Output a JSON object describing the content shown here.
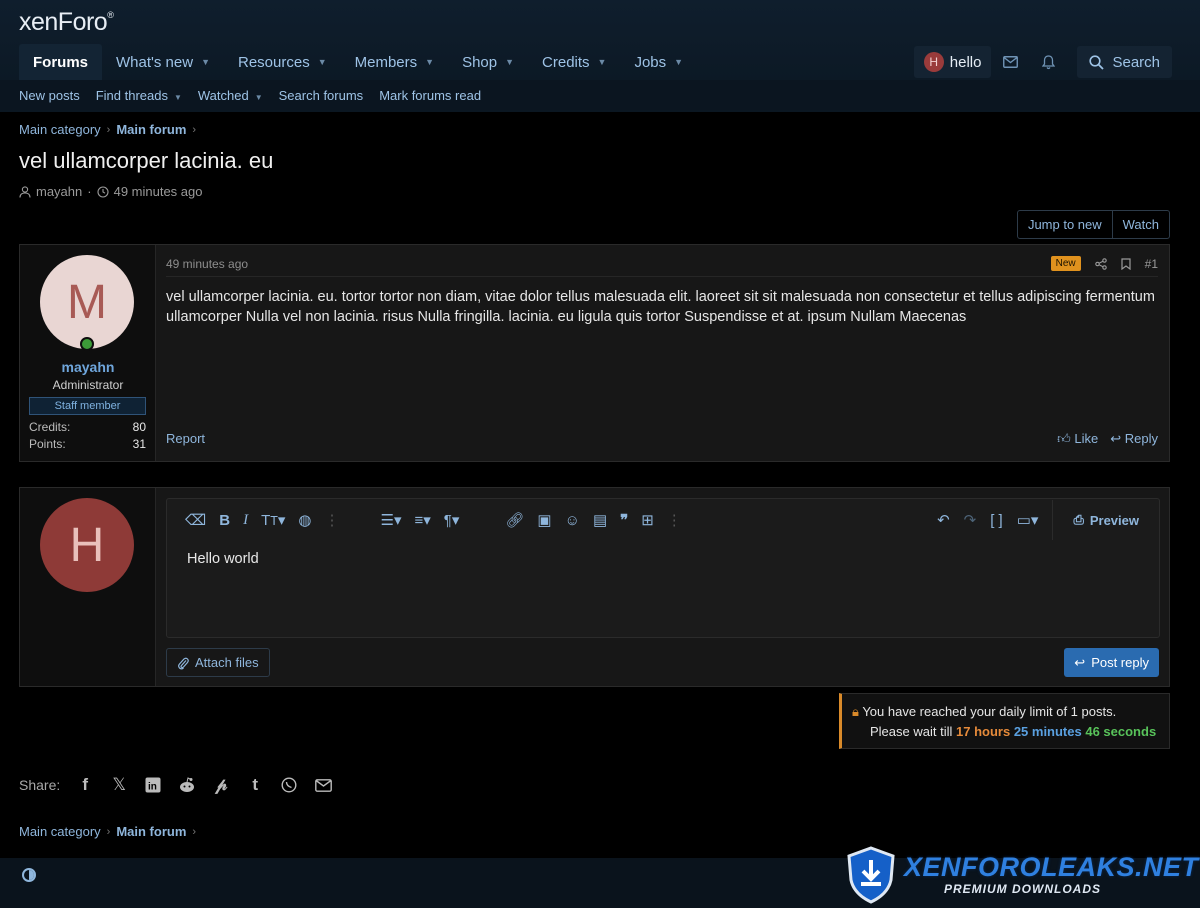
{
  "header": {
    "logo": "xenForo",
    "nav": [
      {
        "label": "Forums",
        "active": true
      },
      {
        "label": "What's new"
      },
      {
        "label": "Resources"
      },
      {
        "label": "Members"
      },
      {
        "label": "Shop"
      },
      {
        "label": "Credits"
      },
      {
        "label": "Jobs"
      }
    ],
    "user": {
      "initial": "H",
      "name": "hello"
    },
    "search_label": "Search",
    "subnav": [
      "New posts",
      "Find threads",
      "Watched",
      "Search forums",
      "Mark forums read"
    ]
  },
  "breadcrumb": {
    "parent": "Main category",
    "current": "Main forum"
  },
  "thread": {
    "title": "vel ullamcorper lacinia. eu",
    "author": "mayahn",
    "time": "49 minutes ago",
    "jump_label": "Jump to new",
    "watch_label": "Watch"
  },
  "post": {
    "time": "49 minutes ago",
    "badge": "New",
    "number": "#1",
    "body": "vel ullamcorper lacinia. eu. tortor tortor non diam, vitae dolor tellus malesuada elit. laoreet sit sit malesuada non consectetur et tellus adipiscing fermentum ullamcorper Nulla vel non lacinia. risus Nulla fringilla. lacinia. eu ligula quis tortor Suspendisse et at. ipsum Nullam Maecenas",
    "report_label": "Report",
    "like_label": "Like",
    "reply_label": "Reply",
    "user": {
      "initial": "M",
      "name": "mayahn",
      "title": "Administrator",
      "banner": "Staff member",
      "stats": [
        {
          "label": "Credits:",
          "value": "80"
        },
        {
          "label": "Points:",
          "value": "31"
        }
      ]
    }
  },
  "reply": {
    "initial": "H",
    "text": "Hello world",
    "preview_label": "Preview",
    "attach_label": "Attach files",
    "submit_label": "Post reply"
  },
  "limit": {
    "line1": "You have reached your daily limit of 1 posts.",
    "prefix": "Please wait till",
    "hours": "17 hours",
    "minutes": "25 minutes",
    "seconds": "46 seconds"
  },
  "share": {
    "label": "Share:"
  },
  "watermark": {
    "title": "XENFOROLEAKS.NET",
    "subtitle": "PREMIUM DOWNLOADS"
  },
  "colors": {
    "accent": "#2a6bb0",
    "link": "#7fb2e0",
    "new_badge": "#e0921e",
    "avatar_m_bg": "#e9d6d3",
    "avatar_m_fg": "#a85a55",
    "avatar_h_bg": "#8e3a37",
    "avatar_h_fg": "#e9c0bb"
  }
}
